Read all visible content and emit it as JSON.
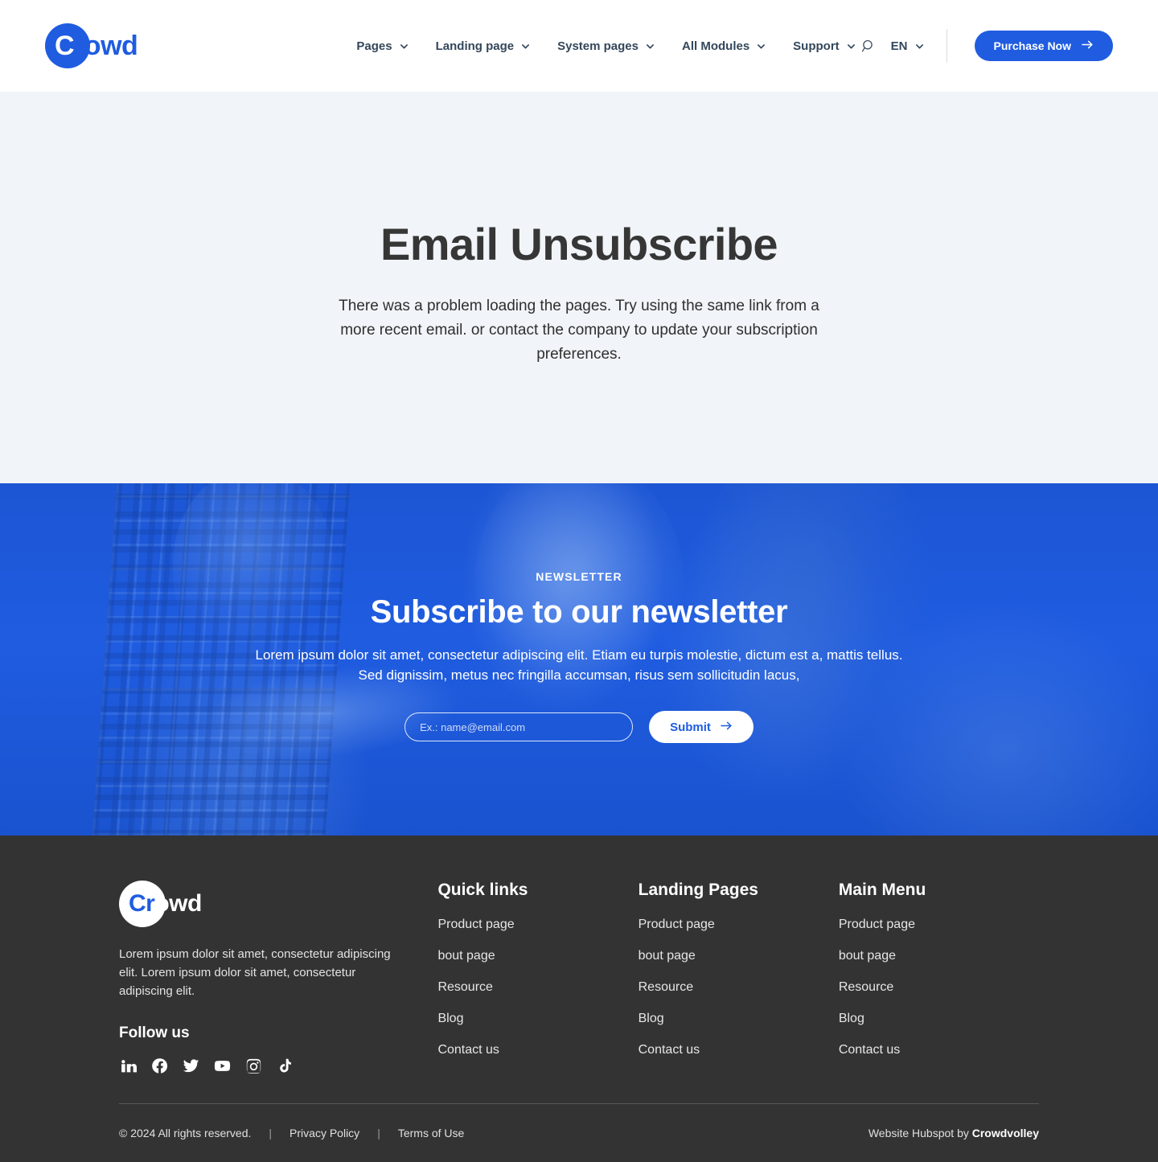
{
  "header": {
    "logo": {
      "circle_letter": "C",
      "rest": "rowd",
      "full": "Crowd"
    },
    "nav": [
      {
        "label": "Pages",
        "icon": "chevron-down-icon"
      },
      {
        "label": "Landing page",
        "icon": "chevron-down-icon"
      },
      {
        "label": "System pages",
        "icon": "chevron-down-icon"
      },
      {
        "label": "All Modules",
        "icon": "chevron-down-icon"
      },
      {
        "label": "Support",
        "icon": "chevron-down-icon"
      }
    ],
    "search_icon": "search-icon",
    "language": {
      "label": "EN",
      "icon": "chevron-down-icon"
    },
    "cta": {
      "label": "Purchase Now",
      "icon": "arrow-right-icon",
      "color": "#1f5ce0"
    }
  },
  "hero": {
    "title": "Email Unsubscribe",
    "description": "There was a problem loading the pages. Try using the same link from a more recent email. or contact the company to update your subscription preferences.",
    "background": "#f1f4f8"
  },
  "newsletter": {
    "eyebrow": "NEWSLETTER",
    "title": "Subscribe to our newsletter",
    "description": "Lorem ipsum dolor sit amet, consectetur adipiscing elit. Etiam eu turpis molestie, dictum est a, mattis tellus. Sed dignissim, metus nec fringilla accumsan, risus sem sollicitudin lacus,",
    "email_placeholder": "Ex.: name@email.com",
    "email_value": "",
    "submit_label": "Submit",
    "submit_icon": "arrow-right-icon",
    "background": "#1f5ce0"
  },
  "footer": {
    "logo": {
      "circle_letter": "Cr",
      "rest": "owd",
      "full": "Crowd"
    },
    "description": "Lorem ipsum dolor sit amet, consectetur adipiscing elit. Lorem ipsum dolor sit amet, consectetur adipiscing elit.",
    "follow_title": "Follow us",
    "socials": [
      {
        "name": "linkedin-icon",
        "label": "LinkedIn"
      },
      {
        "name": "facebook-icon",
        "label": "Facebook"
      },
      {
        "name": "twitter-icon",
        "label": "Twitter"
      },
      {
        "name": "youtube-icon",
        "label": "YouTube"
      },
      {
        "name": "instagram-icon",
        "label": "Instagram"
      },
      {
        "name": "tiktok-icon",
        "label": "TikTok"
      }
    ],
    "columns": [
      {
        "title": "Quick links",
        "links": [
          "Product page",
          "bout page",
          "Resource",
          "Blog",
          "Contact us"
        ]
      },
      {
        "title": "Landing Pages",
        "links": [
          "Product page",
          "bout page",
          "Resource",
          "Blog",
          "Contact us"
        ]
      },
      {
        "title": "Main Menu",
        "links": [
          "Product page",
          "bout page",
          "Resource",
          "Blog",
          "Contact us"
        ]
      }
    ],
    "bottom": {
      "copyright": "© 2024 All rights reserved.",
      "sep1": "|",
      "privacy": "Privacy Policy",
      "sep2": "|",
      "terms": "Terms of Use",
      "credit_prefix": "Website Hubspot by ",
      "credit_brand": "Crowdvolley"
    },
    "background": "#333333"
  }
}
